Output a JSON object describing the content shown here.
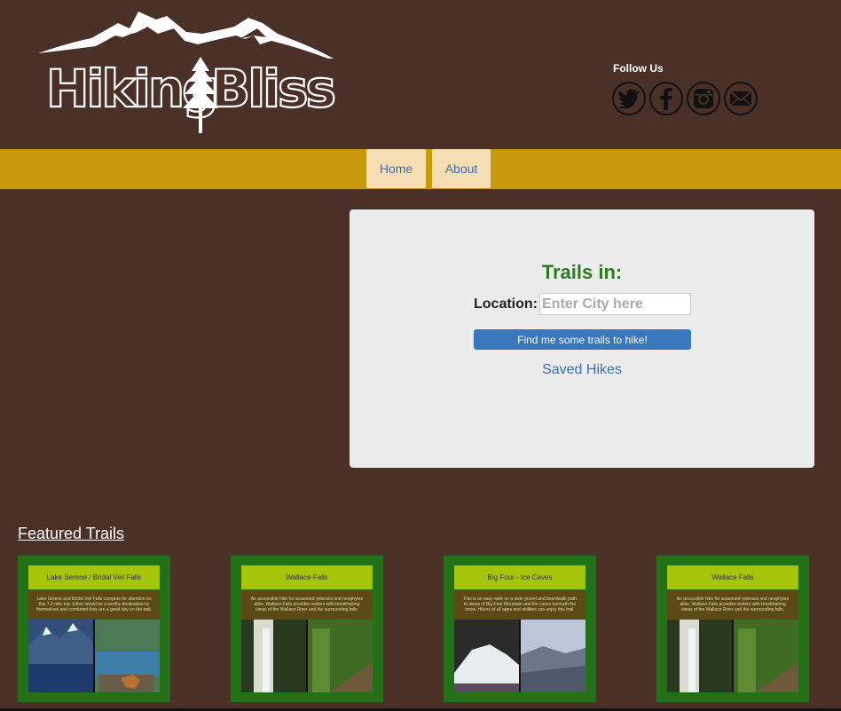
{
  "brand": {
    "logo_text": "HikingBliss"
  },
  "follow": {
    "title": "Follow Us",
    "icons": [
      "twitter-icon",
      "facebook-icon",
      "instagram-icon",
      "email-icon"
    ]
  },
  "nav": {
    "home": "Home",
    "about": "About"
  },
  "search": {
    "title": "Trails in:",
    "location_label": "Location:",
    "placeholder": "Enter City here",
    "button": "Find me some trails to hike!",
    "saved_link": "Saved Hikes"
  },
  "featured": {
    "title": "Featured Trails",
    "cards": [
      {
        "title": "Lake Serene / Bridal Veil Falls",
        "description": "Lake Serene and Bridal Veil Falls compete for attention on this 7.2 mile trip. Either would be a worthy destination by themselves and combined they are a great day on the trail."
      },
      {
        "title": "Wallace Falls",
        "description": "An accessible hike for seasoned veterans and neophytes alike, Wallace Falls provides visitors with breathtaking views of the Wallace River and the surrounding falls."
      },
      {
        "title": "Big Four - Ice Caves",
        "description": "This is an easy walk on a wide gravel and boardwalk path to views of Big Four Mountain and the caves beneath the snow. Hikers of all ages and abilities can enjoy this trail."
      },
      {
        "title": "Wallace Falls",
        "description": "An accessible hike for seasoned veterans and neophytes alike, Wallace Falls provides visitors with breathtaking views of the Wallace River and the surrounding falls."
      }
    ]
  },
  "colors": {
    "background": "#4a3027",
    "navbar": "#c9990d",
    "nav_item": "#f5deb3",
    "link": "#3a6fb0",
    "panel": "#ececec",
    "panel_title": "#2d7a1f",
    "button": "#3a78bd",
    "card": "#237016",
    "card_header": "#a6c40a",
    "card_desc": "#5c4a16"
  }
}
